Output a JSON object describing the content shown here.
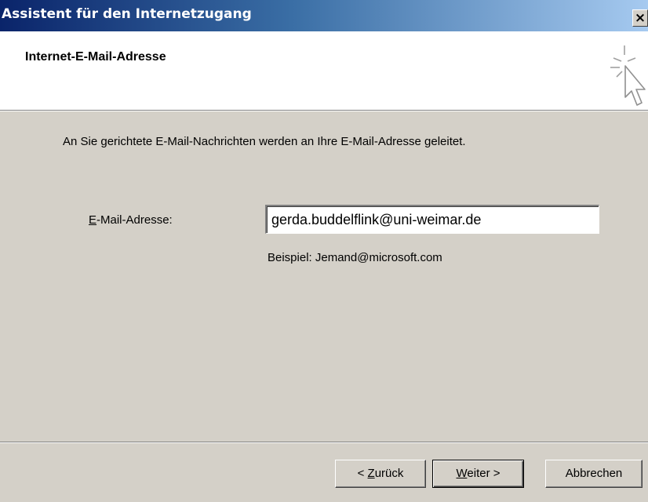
{
  "window": {
    "title": "Assistent für den Internetzugang",
    "close_glyph": "×"
  },
  "header": {
    "title": "Internet-E-Mail-Adresse",
    "icon": "wizard-cursor-icon"
  },
  "main": {
    "description": "An Sie gerichtete E-Mail-Nachrichten werden an Ihre E-Mail-Adresse geleitet.",
    "email_label_accel": "E",
    "email_label_rest": "-Mail-Adresse:",
    "email_value": "gerda.buddelflink@uni-weimar.de",
    "example": "Beispiel: Jemand@microsoft.com"
  },
  "buttons": {
    "back_prefix": "< ",
    "back_accel": "Z",
    "back_rest": "urück",
    "next_accel": "W",
    "next_rest": "eiter >",
    "cancel": "Abbrechen"
  }
}
